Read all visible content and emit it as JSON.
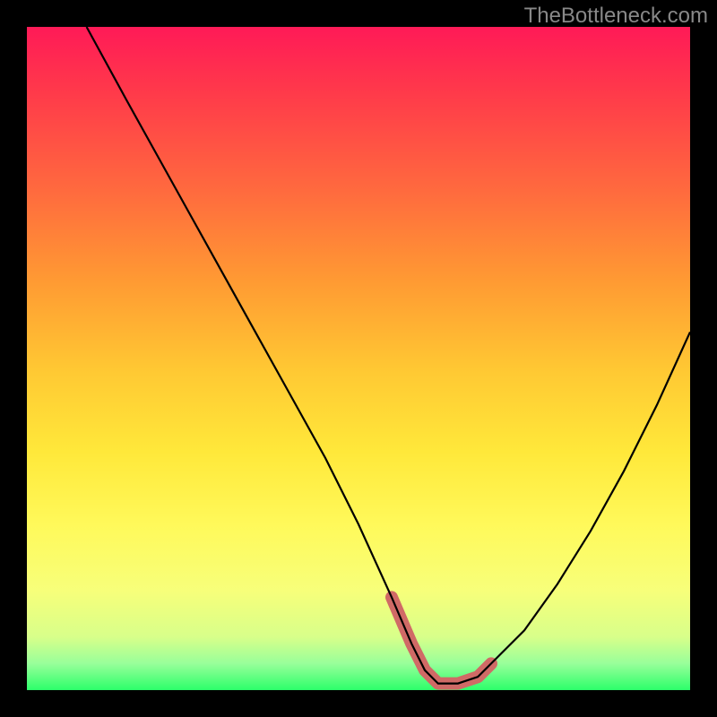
{
  "watermark": "TheBottleneck.com",
  "chart_data": {
    "type": "line",
    "title": "",
    "xlabel": "",
    "ylabel": "",
    "xlim": [
      0,
      100
    ],
    "ylim": [
      0,
      100
    ],
    "grid": false,
    "background_gradient": {
      "top_color": "#ff1a57",
      "bottom_color": "#2cff6a",
      "description": "red-orange-yellow-green vertical gradient"
    },
    "series": [
      {
        "name": "bottleneck-curve",
        "description": "V-shaped curve with minimum near x≈62",
        "x": [
          9,
          15,
          20,
          25,
          30,
          35,
          40,
          45,
          50,
          55,
          58,
          60,
          62,
          65,
          68,
          70,
          75,
          80,
          85,
          90,
          95,
          100
        ],
        "values": [
          100,
          89,
          80,
          71,
          62,
          53,
          44,
          35,
          25,
          14,
          7,
          3,
          1,
          1,
          2,
          4,
          9,
          16,
          24,
          33,
          43,
          54
        ]
      }
    ],
    "highlight": {
      "name": "sweet-spot-band",
      "color": "#d06a66",
      "x_range": [
        55,
        70
      ],
      "y_approx": 2,
      "description": "thick reddish marker along curve bottom indicating optimal zone"
    }
  }
}
